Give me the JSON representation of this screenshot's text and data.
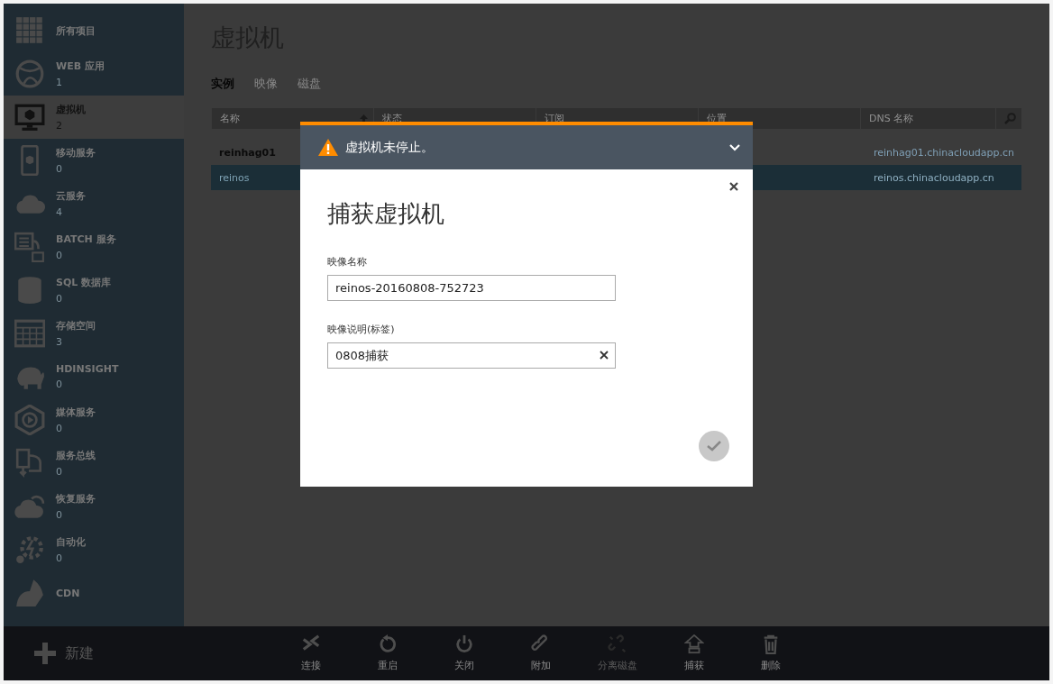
{
  "sidebar": {
    "items": [
      {
        "label": "所有项目",
        "selected": false
      },
      {
        "label": "WEB 应用",
        "count": "1",
        "selected": false
      },
      {
        "label": "虚拟机",
        "count": "2",
        "selected": true
      },
      {
        "label": "移动服务",
        "count": "0",
        "selected": false
      },
      {
        "label": "云服务",
        "count": "4",
        "selected": false
      },
      {
        "label": "BATCH 服务",
        "count": "0",
        "selected": false
      },
      {
        "label": "SQL 数据库",
        "count": "0",
        "selected": false
      },
      {
        "label": "存储空间",
        "count": "3",
        "selected": false
      },
      {
        "label": "HDINSIGHT",
        "count": "0",
        "selected": false
      },
      {
        "label": "媒体服务",
        "count": "0",
        "selected": false
      },
      {
        "label": "服务总线",
        "count": "0",
        "selected": false
      },
      {
        "label": "恢复服务",
        "count": "0",
        "selected": false
      },
      {
        "label": "自动化",
        "count": "0",
        "selected": false
      },
      {
        "label": "CDN",
        "selected": false
      }
    ]
  },
  "page": {
    "title": "虚拟机",
    "tabs": [
      {
        "label": "实例",
        "selected": true
      },
      {
        "label": "映像",
        "selected": false
      },
      {
        "label": "磁盘",
        "selected": false
      }
    ],
    "table": {
      "columns": [
        "名称",
        "状态",
        "订阅",
        "位置",
        "DNS 名称"
      ],
      "rows": [
        {
          "name": "reinhag01",
          "dns": "reinhag01.chinacloudapp.cn",
          "selected": false
        },
        {
          "name": "reinos",
          "dns": "reinos.chinacloudapp.cn",
          "selected": true
        }
      ]
    }
  },
  "dialog": {
    "alert": "虚拟机未停止。",
    "title": "捕获虚拟机",
    "fields": [
      {
        "label": "映像名称",
        "value": "reinos-20160808-752723"
      },
      {
        "label": "映像说明(标签)",
        "value": "0808捕获"
      }
    ]
  },
  "command_bar": {
    "new_label": "新建",
    "actions": [
      {
        "label": "连接",
        "disabled": false
      },
      {
        "label": "重启",
        "disabled": false
      },
      {
        "label": "关闭",
        "disabled": false
      },
      {
        "label": "附加",
        "disabled": false
      },
      {
        "label": "分离磁盘",
        "disabled": true
      },
      {
        "label": "捕获",
        "disabled": false
      },
      {
        "label": "删除",
        "disabled": false
      }
    ]
  }
}
